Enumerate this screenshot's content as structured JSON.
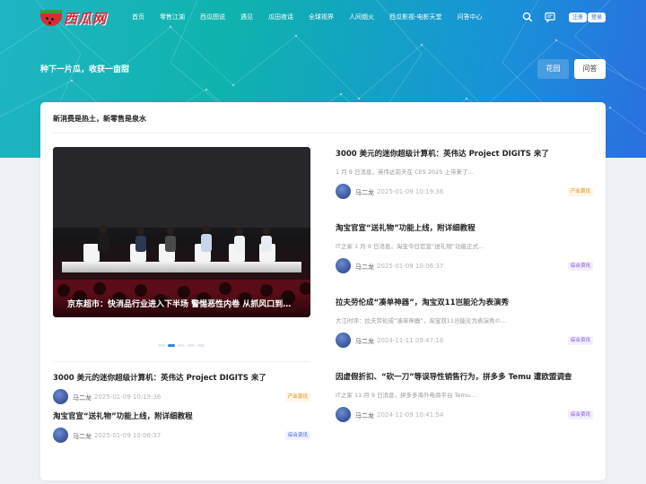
{
  "header": {
    "logo_text": "西瓜网",
    "nav": [
      "首页",
      "零售江湖",
      "西瓜图说",
      "遇见",
      "瓜田夜话",
      "全球视界",
      "人间烟火",
      "西瓜影视-电影天堂",
      "问答中心"
    ],
    "register_label": "注册",
    "login_label": "登录"
  },
  "hero": {
    "slogan": "种下一片瓜，收获一亩甜",
    "btn_garden": "花园",
    "btn_qa": "问答"
  },
  "card": {
    "title": "新消费是热土，新零售是泉水",
    "slider": {
      "caption": "京东超市：快消品行业进入下半场 警惕恶性内卷 从抓风口到抓确定性",
      "dots": 5,
      "active_dot": 1
    },
    "bottom_posts": [
      {
        "title": "3000 美元的迷你超级计算机：英伟达 Project DIGITS 来了",
        "author": "马二龙",
        "time": "2025-01-09 10:19:36",
        "tag": "产业资讯",
        "tag_color": "orange"
      },
      {
        "title": "淘宝官宣“送礼物”功能上线，附详细教程",
        "author": "马二龙",
        "time": "2025-01-09 10:06:37",
        "tag": "综合资讯",
        "tag_color": "blue"
      }
    ],
    "right_posts": [
      {
        "title": "3000 美元的迷你超级计算机：英伟达 Project DIGITS 来了",
        "excerpt": "1 月 9 日消息，英伟达前天在 CES 2025 上带来了…",
        "author": "马二龙",
        "time": "2025-01-09 10:19:36",
        "tag": "产业资讯",
        "tag_color": "orange"
      },
      {
        "title": "淘宝官宣“送礼物”功能上线，附详细教程",
        "excerpt": "IT之家 1 月 9 日消息，淘宝今日官宣“送礼物”功能正式…",
        "author": "马二龙",
        "time": "2025-01-09 10:06:37",
        "tag": "综合资讯",
        "tag_color": "purple"
      },
      {
        "title": "拉夫劳伦成“凑单神器”，淘宝双11岂能沦为表演秀",
        "excerpt": "大江时评：拉夫劳伦成“凑单神器”，淘宝双11岂能沦为表演秀©…",
        "author": "马二龙",
        "time": "2024-11-11 09:47:16",
        "tag": "综合资讯",
        "tag_color": "purple"
      },
      {
        "title": "因虚假折扣、“砍一刀”等误导性销售行为，拼多多 Temu 遭欧盟调查",
        "excerpt": "IT之家 11 月 9 日消息，拼多多海外电商平台 Temu…",
        "author": "马二龙",
        "time": "2024-11-09 10:41:54",
        "tag": "综合资讯",
        "tag_color": "purple"
      }
    ]
  }
}
